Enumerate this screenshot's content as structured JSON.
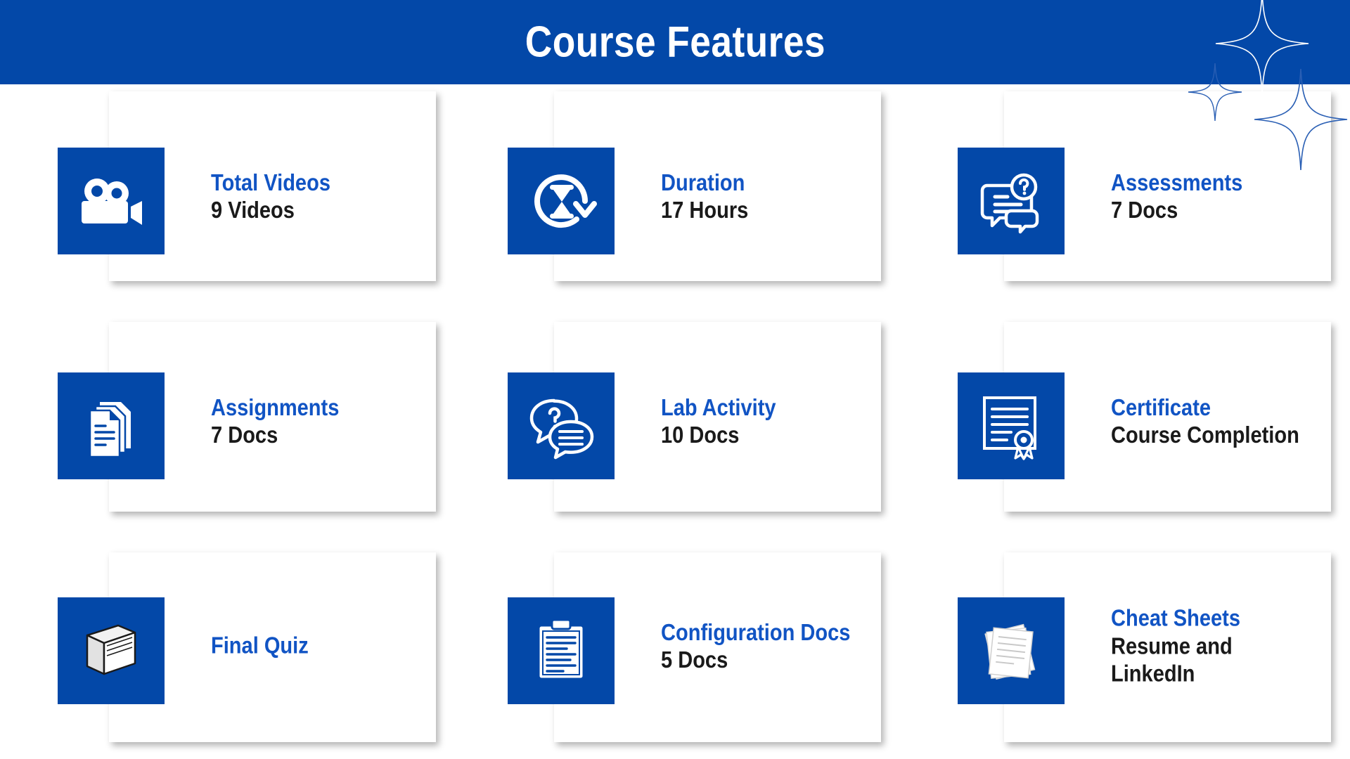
{
  "header": {
    "title": "Course Features",
    "background_color": "#0348a8",
    "title_color": "#ffffff",
    "decoration": "four-point-sparkles"
  },
  "theme": {
    "accent_blue": "#0348a8",
    "title_blue": "#1154c4",
    "text_dark": "#1a1a1a",
    "card_background": "#ffffff",
    "page_background": "#ffffff"
  },
  "cards": [
    {
      "id": "total-videos",
      "icon": "video-camera-icon",
      "title": "Total Videos",
      "subtitle": "9 Videos"
    },
    {
      "id": "duration",
      "icon": "hourglass-clock-icon",
      "title": "Duration",
      "subtitle": "17 Hours"
    },
    {
      "id": "assessments",
      "icon": "question-chat-icon",
      "title": "Assessments",
      "subtitle": "7 Docs"
    },
    {
      "id": "assignments",
      "icon": "documents-stack-icon",
      "title": "Assignments",
      "subtitle": "7 Docs"
    },
    {
      "id": "lab-activity",
      "icon": "chat-bubbles-icon",
      "title": "Lab Activity",
      "subtitle": "10 Docs"
    },
    {
      "id": "certificate",
      "icon": "certificate-ribbon-icon",
      "title": "Certificate",
      "subtitle": "Course Completion"
    },
    {
      "id": "final-quiz",
      "icon": "book-icon",
      "title": "Final Quiz",
      "subtitle": ""
    },
    {
      "id": "configuration-docs",
      "icon": "clipboard-icon",
      "title": "Configuration Docs",
      "subtitle": "5 Docs"
    },
    {
      "id": "cheat-sheets",
      "icon": "papers-stack-icon",
      "title": "Cheat Sheets",
      "subtitle": "Resume and LinkedIn"
    }
  ]
}
